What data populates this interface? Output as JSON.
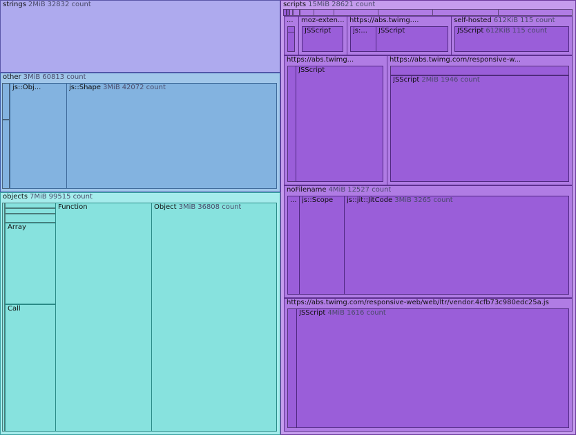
{
  "groups": {
    "strings": {
      "name": "strings",
      "size": "2MiB",
      "count": "32832 count"
    },
    "other": {
      "name": "other",
      "size": "3MiB",
      "count": "60813 count",
      "jsobj": {
        "name": "js::Obj..."
      },
      "jsshape": {
        "name": "js::Shape",
        "size": "3MiB",
        "count": "42072 count"
      }
    },
    "objects": {
      "name": "objects",
      "size": "7MiB",
      "count": "99515 count",
      "array": {
        "name": "Array"
      },
      "call": {
        "name": "Call"
      },
      "function": {
        "name": "Function"
      },
      "object": {
        "name": "Object",
        "size": "3MiB",
        "count": "36808 count"
      }
    },
    "scripts": {
      "name": "scripts",
      "size": "15MiB",
      "count": "28621 count",
      "dots": {
        "name": "..."
      },
      "mozext": {
        "name": "moz-exten...",
        "child": "JSScript"
      },
      "abs1": {
        "name": "https://abs.twimg....",
        "child1": "js:...",
        "child2": "JSScript"
      },
      "selfhosted": {
        "name": "self-hosted",
        "size": "612KiB",
        "count": "115 count",
        "child": {
          "name": "JSScript",
          "size": "612KiB",
          "count": "115 count"
        }
      },
      "abs2": {
        "name": "https://abs.twimg...",
        "child": "JSScript"
      },
      "abs3": {
        "name": "https://abs.twimg.com/responsive-w...",
        "child": {
          "name": "JSScript",
          "size": "2MiB",
          "count": "1946 count"
        }
      },
      "nofilename": {
        "name": "noFilename",
        "size": "4MiB",
        "count": "12527 count",
        "dots": "...",
        "scope": {
          "name": "js::Scope"
        },
        "jitcode": {
          "name": "js::jit::JitCode",
          "size": "3MiB",
          "count": "3265 count"
        }
      },
      "vendor": {
        "name": "https://abs.twimg.com/responsive-web/web/ltr/vendor.4cfb73c980edc25a.js",
        "child": {
          "name": "JSScript",
          "size": "4MiB",
          "count": "1616 count"
        }
      }
    }
  }
}
